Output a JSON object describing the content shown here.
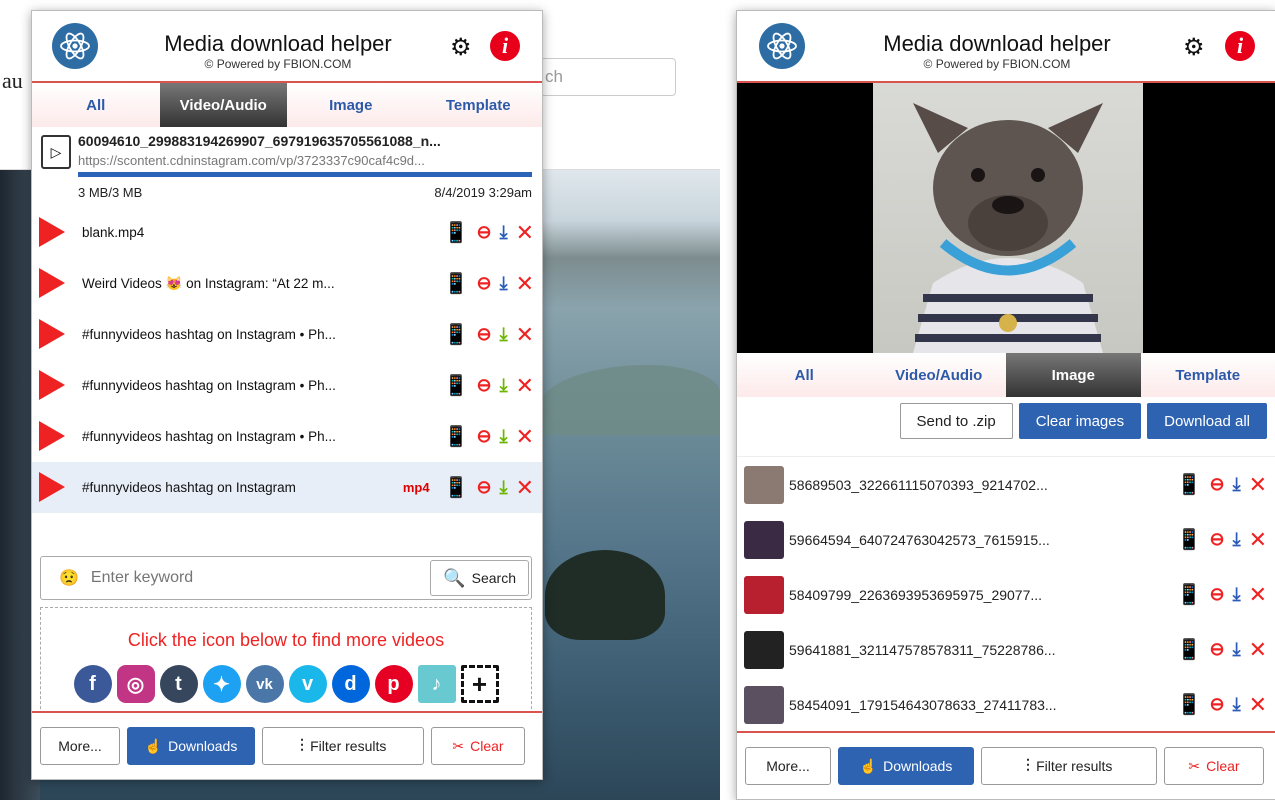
{
  "background": {
    "logo": "au",
    "search_placeholder": "ch"
  },
  "popup1": {
    "title": "Media download helper",
    "subtitle": "© Powered by FBION.COM",
    "tabs": [
      "All",
      "Video/Audio",
      "Image",
      "Template"
    ],
    "active_tab": "Video/Audio",
    "current_download": {
      "name": "60094610_299883194269907_697919635705561088_n...",
      "url": "https://scontent.cdninstagram.com/vp/3723337c90caf4c9d...",
      "progress": 1.0,
      "size": "3 MB/3 MB",
      "date": "8/4/2019 3:29am"
    },
    "items": [
      {
        "name": "blank.mp4",
        "download_color": "blue"
      },
      {
        "name": "Weird Videos 😻 on Instagram: “At 22 m...",
        "download_color": "blue"
      },
      {
        "name": "#funnyvideos hashtag on Instagram • Ph...",
        "download_color": "green"
      },
      {
        "name": "#funnyvideos hashtag on Instagram • Ph...",
        "download_color": "green"
      },
      {
        "name": "#funnyvideos hashtag on Instagram • Ph...",
        "download_color": "green"
      },
      {
        "name": "#funnyvideos hashtag on Instagram",
        "tag": "mp4",
        "download_color": "green"
      }
    ],
    "search": {
      "placeholder": "Enter keyword",
      "button": "Search"
    },
    "find_text": "Click the icon below to find more videos",
    "bottom": {
      "more": "More...",
      "downloads": "Downloads",
      "filter": "Filter results",
      "clear": "Clear"
    }
  },
  "popup2": {
    "title": "Media download helper",
    "subtitle": "© Powered by FBION.COM",
    "tabs": [
      "All",
      "Video/Audio",
      "Image",
      "Template"
    ],
    "active_tab": "Image",
    "actions": {
      "zip": "Send to .zip",
      "clear_images": "Clear images",
      "download_all": "Download all"
    },
    "items": [
      {
        "name": "58689503_322661115070393_9214702..."
      },
      {
        "name": "59664594_640724763042573_7615915..."
      },
      {
        "name": "58409799_2263693953695975_29077..."
      },
      {
        "name": "59641881_321147578578311_75228786..."
      },
      {
        "name": "58454091_179154643078633_27411783..."
      }
    ],
    "bottom": {
      "more": "More...",
      "downloads": "Downloads",
      "filter": "Filter results",
      "clear": "Clear"
    }
  },
  "colors": {
    "accent_red": "#d9534f",
    "brand_blue": "#2e63b2",
    "tab_text": "#2d5aa8"
  }
}
